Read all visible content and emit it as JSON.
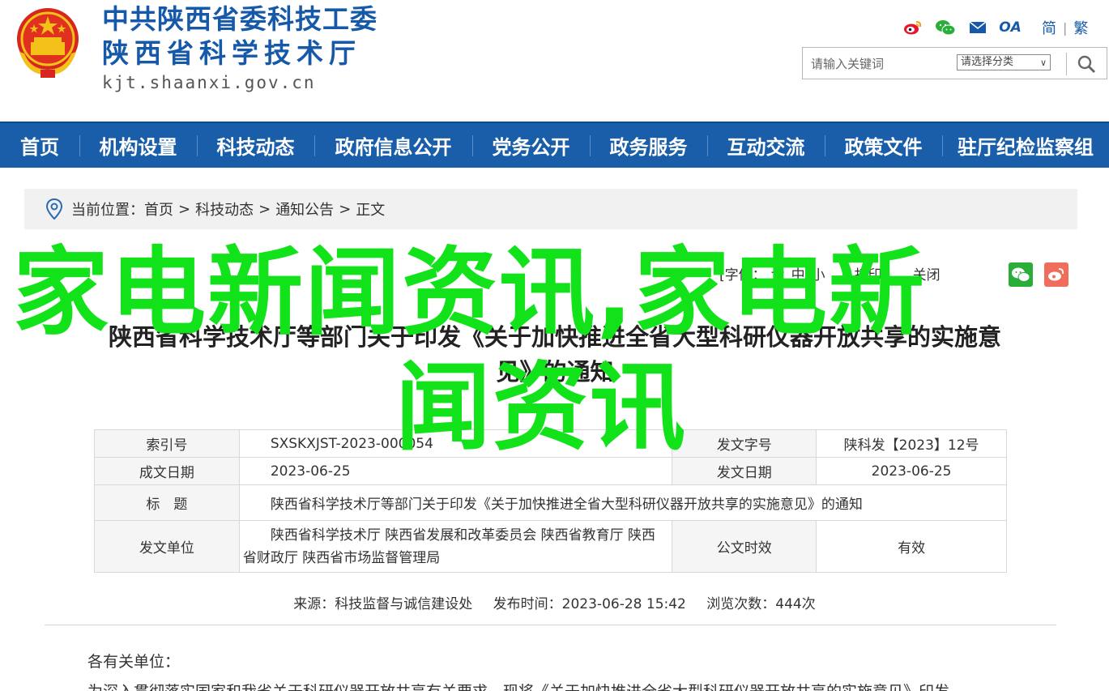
{
  "header": {
    "emblem_icon": "national-emblem-icon",
    "title_line1": "中共陕西省委科技工委",
    "title_line2": "陕西省科学技术厅",
    "domain": "kjt.shaanxi.gov.cn",
    "tool_icons": [
      "weibo-icon",
      "wechat-icon",
      "mail-icon",
      "oa-icon"
    ],
    "oa_label": "OA",
    "lang_simplified": "简",
    "lang_sep": "|",
    "lang_traditional": "繁",
    "search": {
      "placeholder": "请输入关键词",
      "category_selected": "请选择分类",
      "button_icon": "search-icon"
    }
  },
  "nav": {
    "items": [
      {
        "label": "首页",
        "width": 98
      },
      {
        "label": "机构设置",
        "width": 145
      },
      {
        "label": "科技动态",
        "width": 145
      },
      {
        "label": "政府信息公开",
        "width": 195
      },
      {
        "label": "党务公开",
        "width": 145
      },
      {
        "label": "政务服务",
        "width": 145
      },
      {
        "label": "互动交流",
        "width": 145
      },
      {
        "label": "政策文件",
        "width": 145
      },
      {
        "label": "驻厅纪检监察组",
        "width": 206
      }
    ]
  },
  "breadcrumb": {
    "icon": "location-pin-icon",
    "prefix": "当前位置：",
    "items": [
      "首页",
      "科技动态",
      "通知公告",
      "正文"
    ],
    "sep": ">"
  },
  "article_tools": {
    "font_size_label": "[字体：",
    "font_size_options": [
      "大",
      "中",
      "小"
    ],
    "print": "打印",
    "close": "关闭",
    "share_icons": [
      "wechat-share-icon",
      "weibo-share-icon"
    ]
  },
  "article": {
    "title_line1": "陕西省科学技术厅等部门关于印发《关于加快推进全省大型科研仪器开放共享的实施意",
    "title_line2": "见》的通知",
    "meta": {
      "index_no_label": "索引号",
      "index_no": "SXSKXJST-2023-000054",
      "doc_no_label": "发文字号",
      "doc_no": "陕科发【2023】12号",
      "written_date_label": "成文日期",
      "written_date": "2023-06-25",
      "issue_date_label": "发文日期",
      "issue_date": "2023-06-25",
      "title_label": "标　题",
      "title": "陕西省科学技术厅等部门关于印发《关于加快推进全省大型科研仪器开放共享的实施意见》的通知",
      "issuer_label": "发文单位",
      "issuer": "陕西省科学技术厅 陕西省发展和改革委员会 陕西省教育厅 陕西省财政厅 陕西省市场监督管理局",
      "validity_label": "公文时效",
      "validity": "有效"
    },
    "source_label": "来源：",
    "source": "科技监督与诚信建设处",
    "publish_label": "发布时间：",
    "publish_time": "2023-06-28 15:42",
    "views_label": "浏览次数：",
    "views": "444次",
    "salutation": "各有关单位：",
    "body_partial": "为深入贯彻落实国家和我省关于科研仪器开放共享有关要求，现将《关于加快推进全省大型科研仪器开放共享的实施意见》印发"
  },
  "watermark": {
    "line1": "家电新闻资讯,家电新",
    "line2": "闻资讯",
    "color": "#12e21a"
  },
  "colors": {
    "brand_blue": "#1a5ea9",
    "title_blue": "#1659a8"
  }
}
